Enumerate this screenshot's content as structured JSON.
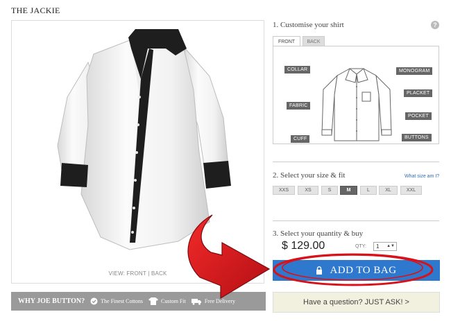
{
  "product": {
    "title": "THE JACKIE",
    "view_toggle": "VIEW: FRONT | BACK"
  },
  "why_bar": {
    "title": "WHY JOE BUTTON?",
    "features": [
      "The Finest Cottons",
      "Custom Fit",
      "Free Delivery"
    ]
  },
  "customise": {
    "step_title": "1. Customise your shirt",
    "help_icon": "?",
    "tabs": {
      "front": "FRONT",
      "back": "BACK"
    },
    "labels": {
      "collar": "COLLAR",
      "fabric": "FABRIC",
      "cuff": "CUFF",
      "monogram": "MONOGRAM",
      "placket": "PLACKET",
      "pocket": "POCKET",
      "buttons": "BUTTONS"
    }
  },
  "size": {
    "step_title": "2. Select your size & fit",
    "help_link": "What size am I?",
    "options": [
      "XXS",
      "XS",
      "S",
      "M",
      "L",
      "XL",
      "XXL"
    ],
    "selected": "M"
  },
  "quantity": {
    "step_title": "3. Select your quantity & buy",
    "price": "$ 129.00",
    "qty_label": "QTY:",
    "qty_value": "1"
  },
  "buttons": {
    "add_to_bag": "ADD TO BAG",
    "ask": "Have a question? JUST ASK! >"
  },
  "colors": {
    "add_button": "#2e79cd",
    "why_bar": "#9a9a9a",
    "ask_button": "#f2f0de",
    "arrow": "#d8121b"
  }
}
